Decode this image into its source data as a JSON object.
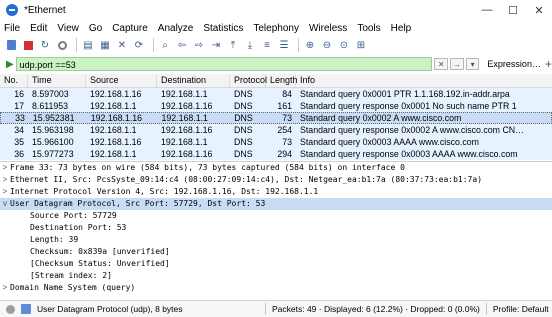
{
  "window": {
    "title": "*Ethernet",
    "controls": [
      "—",
      "☐",
      "✕"
    ]
  },
  "menu": [
    "File",
    "Edit",
    "View",
    "Go",
    "Capture",
    "Analyze",
    "Statistics",
    "Telephony",
    "Wireless",
    "Tools",
    "Help"
  ],
  "filter": {
    "value": "udp.port ==53",
    "expression_label": "Expression…",
    "plus": "+"
  },
  "packet_list": {
    "columns": [
      "No.",
      "Time",
      "Source",
      "Destination",
      "Protocol",
      "Length",
      "Info"
    ],
    "rows": [
      {
        "no": "16",
        "time": "8.597003",
        "src": "192.168.1.16",
        "dst": "192.168.1.1",
        "proto": "DNS",
        "len": "84",
        "info": "Standard query 0x0001 PTR 1.1.168.192.in-addr.arpa",
        "selected": false
      },
      {
        "no": "17",
        "time": "8.611953",
        "src": "192.168.1.1",
        "dst": "192.168.1.16",
        "proto": "DNS",
        "len": "161",
        "info": "Standard query response 0x0001 No such name PTR 1",
        "selected": false
      },
      {
        "no": "33",
        "time": "15.952381",
        "src": "192.168.1.16",
        "dst": "192.168.1.1",
        "proto": "DNS",
        "len": "73",
        "info": "Standard query 0x0002 A www.cisco.com",
        "selected": true
      },
      {
        "no": "34",
        "time": "15.963198",
        "src": "192.168.1.1",
        "dst": "192.168.1.16",
        "proto": "DNS",
        "len": "254",
        "info": "Standard query response 0x0002 A www.cisco.com CN…",
        "selected": false
      },
      {
        "no": "35",
        "time": "15.966100",
        "src": "192.168.1.16",
        "dst": "192.168.1.1",
        "proto": "DNS",
        "len": "73",
        "info": "Standard query 0x0003 AAAA www.cisco.com",
        "selected": false
      },
      {
        "no": "36",
        "time": "15.977273",
        "src": "192.168.1.1",
        "dst": "192.168.1.16",
        "proto": "DNS",
        "len": "294",
        "info": "Standard query response 0x0003 AAAA www.cisco.com",
        "selected": false
      }
    ]
  },
  "details": {
    "lines": [
      {
        "caret": ">",
        "text": "Frame 33: 73 bytes on wire (584 bits), 73 bytes captured (584 bits) on interface 0",
        "indent": 0,
        "selected": false
      },
      {
        "caret": ">",
        "text": "Ethernet II, Src: PcsSyste_09:14:c4 (08:00:27:09:14:c4), Dst: Netgear_ea:b1:7a (80:37:73:ea:b1:7a)",
        "indent": 0,
        "selected": false
      },
      {
        "caret": ">",
        "text": "Internet Protocol Version 4, Src: 192.168.1.16, Dst: 192.168.1.1",
        "indent": 0,
        "selected": false
      },
      {
        "caret": "v",
        "text": "User Datagram Protocol, Src Port: 57729, Dst Port: 53",
        "indent": 0,
        "selected": true
      },
      {
        "caret": "",
        "text": "Source Port: 57729",
        "indent": 1,
        "selected": false
      },
      {
        "caret": "",
        "text": "Destination Port: 53",
        "indent": 1,
        "selected": false
      },
      {
        "caret": "",
        "text": "Length: 39",
        "indent": 1,
        "selected": false
      },
      {
        "caret": "",
        "text": "Checksum: 0x839a [unverified]",
        "indent": 1,
        "selected": false
      },
      {
        "caret": "",
        "text": "[Checksum Status: Unverified]",
        "indent": 1,
        "selected": false
      },
      {
        "caret": "",
        "text": "[Stream index: 2]",
        "indent": 1,
        "selected": false
      },
      {
        "caret": ">",
        "text": "Domain Name System (query)",
        "indent": 0,
        "selected": false
      }
    ]
  },
  "status": {
    "left": "User Datagram Protocol (udp), 8 bytes",
    "packets": "Packets: 49 · Displayed: 6 (12.2%) · Dropped: 0 (0.0%)",
    "profile": "Profile: Default"
  },
  "colors": {
    "row_bg": "#e6f2ff",
    "selected_bg": "#c8ddf5",
    "filter_bg": "#c9f3c3"
  }
}
